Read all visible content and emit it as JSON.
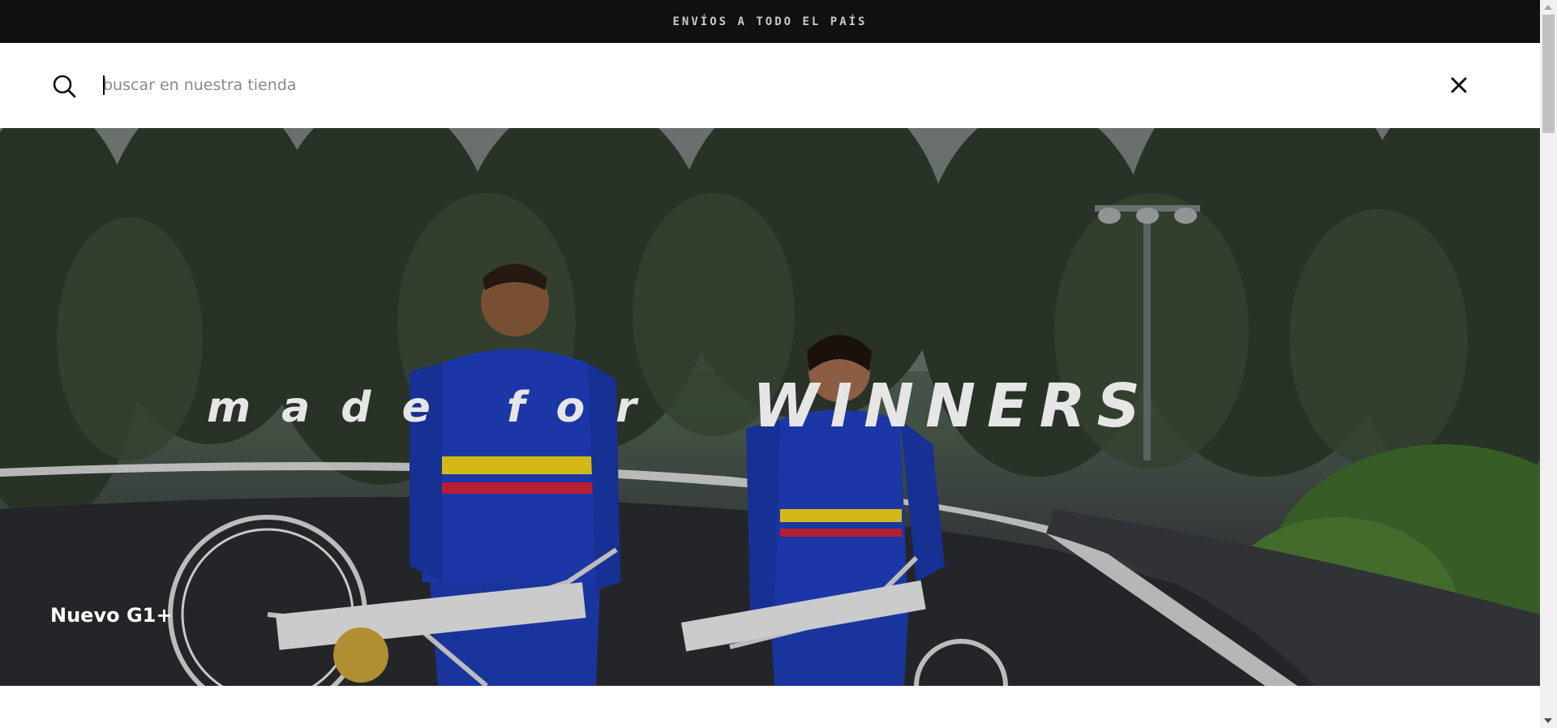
{
  "announcement": {
    "text": "ENVÍOS A TODO EL PAÍS"
  },
  "search": {
    "placeholder": "buscar en nuestra tienda",
    "value": ""
  },
  "hero": {
    "headline_part1": "made for",
    "headline_part2": "WINNERS",
    "caption": "Nuevo G1+"
  },
  "icons": {
    "search": "search-icon",
    "close": "close-icon"
  },
  "colors": {
    "announcement_bg": "#101010",
    "announcement_text": "#c9c9c9",
    "jersey_blue": "#1f3fbf",
    "stripe_yellow": "#f2d21b",
    "stripe_red": "#d1233a"
  }
}
